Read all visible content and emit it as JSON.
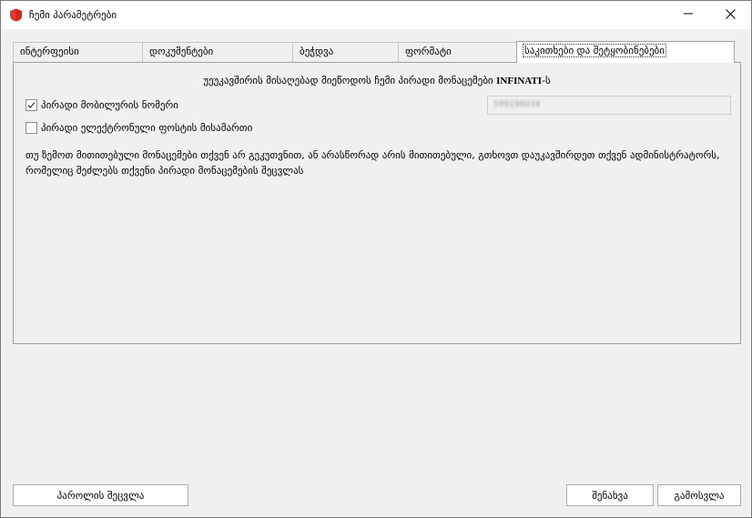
{
  "window": {
    "title": "ჩემი პარამეტრები",
    "app_icon": "shield-icon",
    "brand_color": "#e8382d",
    "minimize_icon": "minimize-icon",
    "close_icon": "close-icon"
  },
  "tabs": [
    {
      "label": "ინტერფეისი",
      "active": false
    },
    {
      "label": "დოკუმენტები",
      "active": false
    },
    {
      "label": "ბეჭდვა",
      "active": false
    },
    {
      "label": "ფორმატი",
      "active": false
    },
    {
      "label": "საკითხები და შეტყობინებები",
      "active": true
    }
  ],
  "panel": {
    "heading_prefix": "უეუკავშირის მისაღებად მიეწოდოს ჩემი პირადი მონაცემები",
    "heading_brand": "INFINATI",
    "heading_suffix": "-ს",
    "mobile_checkbox": {
      "label": "პირადი მობილურის ნომერი",
      "checked": true
    },
    "mobile_value": "599198034",
    "email_checkbox": {
      "label": "პირადი ელექტრონული ფოსტის მისამართი",
      "checked": false
    },
    "notice": "თუ ზემოთ მითითებული მონაცემები თქვენ არ გეკუთვნით, ან არასწორად არის მითითებული, გთხოვთ დაუკავშირდეთ თქვენ ადმინისტრატორს, რომელიც შეძლებს თქვენი პირადი მონაცემების შეცვლას"
  },
  "buttons": {
    "change_password": "პაროლის შეცვლა",
    "save": "შენახვა",
    "exit": "გამოსვლა"
  }
}
